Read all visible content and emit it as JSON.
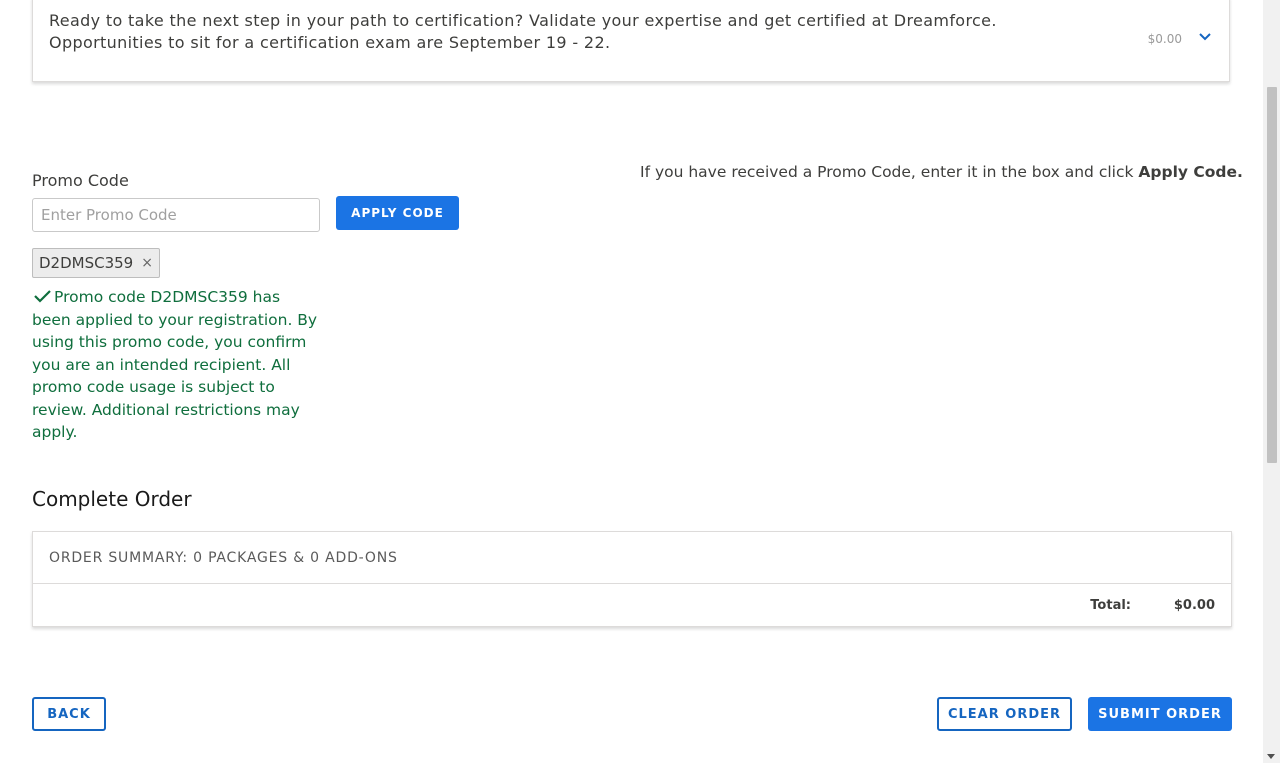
{
  "certification": {
    "line1": "Ready to take the next step in your path to certification? Validate your expertise and get certified at Dreamforce.",
    "line2": "Opportunities to sit for a certification exam are September 19 - 22.",
    "price": "$0.00",
    "expand_icon": "chevron-down-icon"
  },
  "promo": {
    "label": "Promo Code",
    "input_value": "",
    "placeholder": "Enter Promo Code",
    "apply_button": "APPLY CODE",
    "applied_tag": "D2DMSC359",
    "remove_glyph": "×",
    "success_message": "Promo code D2DMSC359 has been applied to your registration. By using this promo code, you confirm you are an intended recipient. All promo code usage is subject to review. Additional restrictions may apply.",
    "help_text": "If you have received a Promo Code, enter it in the box and click ",
    "help_bold": "Apply Code."
  },
  "order": {
    "heading": "Complete Order",
    "summary": "ORDER SUMMARY: 0 PACKAGES & 0 ADD-ONS",
    "total_label": "Total:",
    "total_value": "$0.00"
  },
  "actions": {
    "back": "BACK",
    "clear": "CLEAR ORDER",
    "submit": "SUBMIT ORDER"
  },
  "colors": {
    "primary": "#1b74e4",
    "success": "#0f6e3d",
    "outline": "#1565c0"
  }
}
